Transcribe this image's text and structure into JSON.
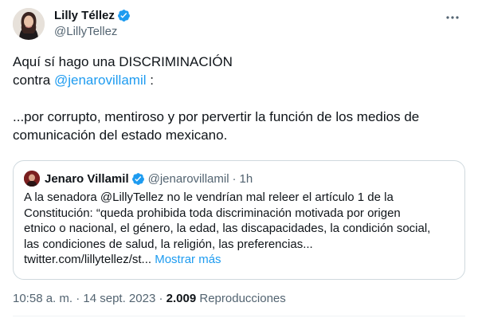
{
  "author": {
    "name": "Lilly Téllez",
    "handle": "@LillyTellez",
    "verified": true
  },
  "tweet": {
    "line1": "Aquí sí hago una DISCRIMINACIÓN",
    "line2_prefix": "contra ",
    "line2_mention": "@jenarovillamil",
    "line2_suffix": " :",
    "line3": "...por corrupto, mentiroso y por pervertir la función de los medios de",
    "line4": "comunicación del estado mexicano."
  },
  "quoted": {
    "name": "Jenaro Villamil",
    "handle": "@jenarovillamil",
    "separator": "·",
    "time": "1h",
    "lines": [
      "A la senadora @LillyTellez no le vendrían mal releer el artículo 1 de la",
      "Constitución: “queda prohibida toda discriminación motivada por origen",
      "etnico o nacional, el género, la edad, las discapacidades, la condición social,",
      "las condiciones de salud, la religión, las preferencias..."
    ],
    "link_text": "twitter.com/lillytellez/st...",
    "show_more": "Mostrar más"
  },
  "meta": {
    "time": "10:58 a. m.",
    "sep1": "·",
    "date": "14 sept. 2023",
    "sep2": "·",
    "views_count": "2.009",
    "views_label": "Reproducciones"
  },
  "colors": {
    "accent": "#1d9bf0",
    "secondary_text": "#536471",
    "border": "#cfd9de"
  },
  "icons": {
    "verified": "verified-badge-icon",
    "more": "more-dots-icon"
  }
}
